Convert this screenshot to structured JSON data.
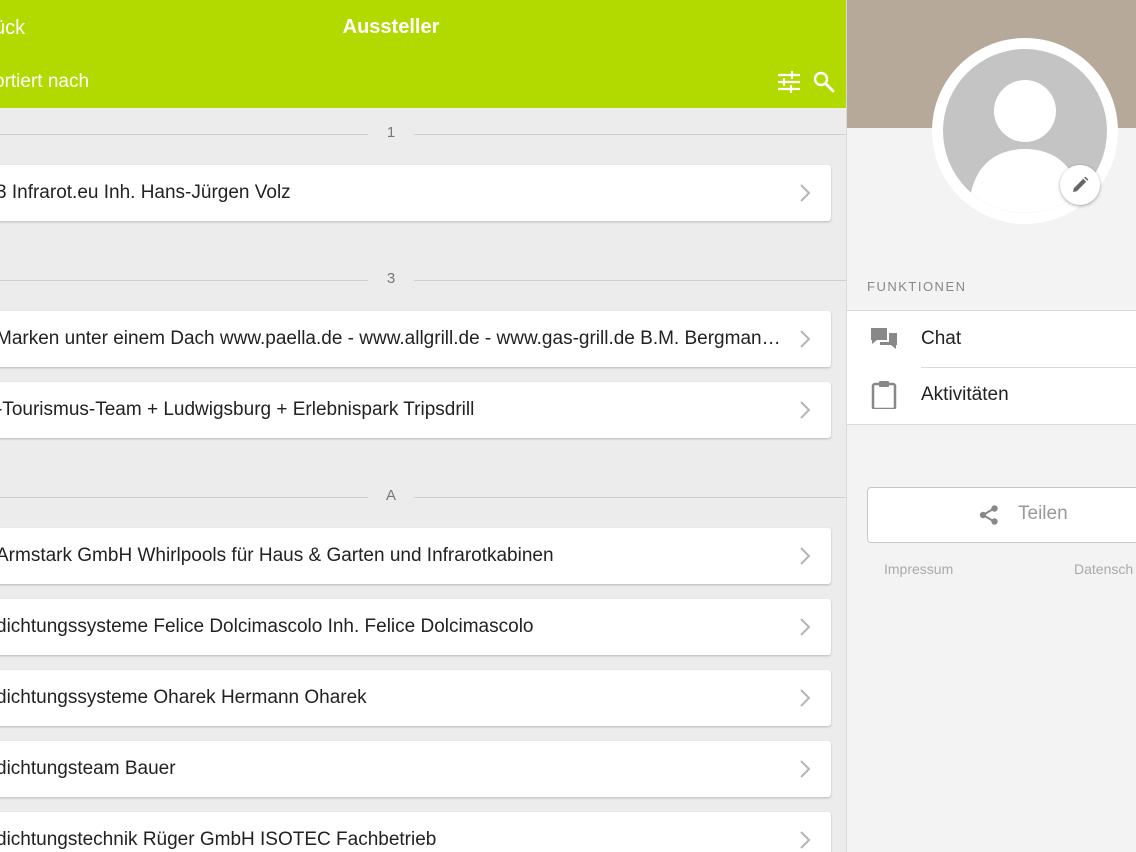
{
  "header": {
    "back_label": "ück",
    "title": "Aussteller",
    "sort_label": "ortiert nach",
    "filter_icon": "tune-icon",
    "search_icon": "search-icon"
  },
  "list": {
    "sections": [
      {
        "letter": "1",
        "items": [
          "3 Infrarot.eu Inh. Hans-Jürgen Volz"
        ]
      },
      {
        "letter": "3",
        "items": [
          "Marken unter einem Dach www.paella.de - www.allgrill.de - www.gas-grill.de B.M. Bergmann & Co. KG",
          "-Tourismus-Team + Ludwigsburg + Erlebnispark Tripsdrill"
        ]
      },
      {
        "letter": "A",
        "items": [
          "Armstark GmbH Whirlpools für Haus & Garten und Infrarotkabinen",
          "dichtungssysteme Felice Dolcimascolo Inh. Felice Dolcimascolo",
          "dichtungssysteme Oharek Hermann Oharek",
          "dichtungsteam Bauer",
          "dichtungstechnik Rüger GmbH ISOTEC Fachbetrieb"
        ]
      }
    ]
  },
  "sidebar": {
    "functions_header": "FUNKTIONEN",
    "functions": [
      {
        "label": "Chat",
        "icon": "chat-icon"
      },
      {
        "label": "Aktivitäten",
        "icon": "clipboard-icon"
      }
    ],
    "share_label": "Teilen",
    "impressum": "Impressum",
    "datenschutz": "Datensch"
  },
  "colors": {
    "accent": "#b2d900",
    "cover": "#b7a99a",
    "avatar": "#c4c4c4"
  }
}
